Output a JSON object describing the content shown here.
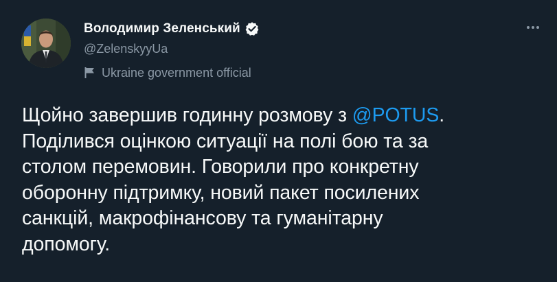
{
  "author": {
    "display_name": "Володимир Зеленський",
    "handle": "@ZelenskyyUa",
    "label": "Ukraine government official"
  },
  "tweet": {
    "line1_before": "Щойно завершив годинну розмову з ",
    "line1_mention": "@POTUS",
    "line1_after": ".",
    "line2": "Поділився оцінкою ситуації на полі бою та за",
    "line3": "столом перемовин. Говорили про конкретну",
    "line4": "оборонну підтримку, новий пакет посилених",
    "line5": "санкцій, макрофінансову та гуманітарну",
    "line6": "допомогу."
  },
  "icons": {
    "verified": "verified-badge-icon",
    "label": "flag-icon",
    "more": "more-options-icon"
  },
  "colors": {
    "background": "#15202b",
    "text_primary": "#f7f9f9",
    "text_secondary": "#8b98a5",
    "accent": "#1d9bf0"
  }
}
